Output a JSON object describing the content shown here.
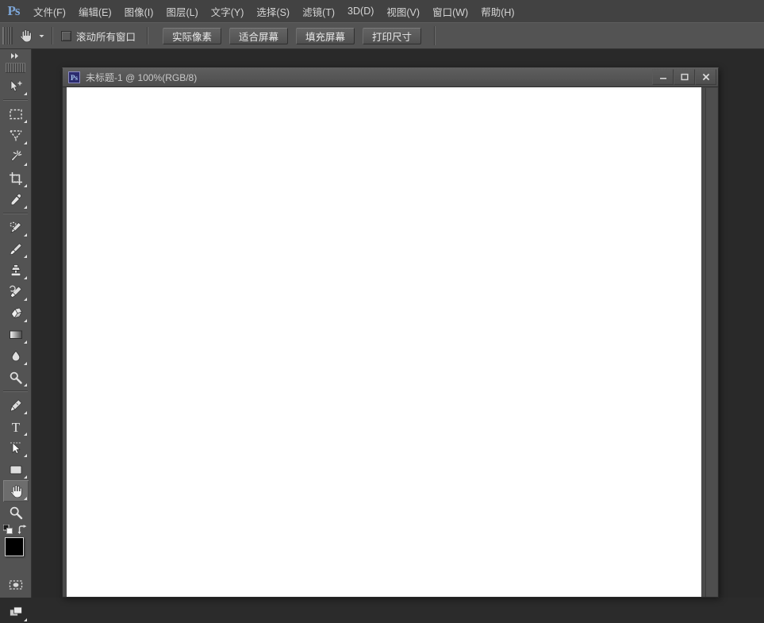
{
  "app": {
    "logo": "Ps",
    "accent_color": "#7da6d8",
    "menubar_bg": "#424242",
    "optionsbar_bg": "#535353",
    "toolbar_bg": "#535353",
    "workspace_bg": "#292929",
    "canvas_bg": "#ffffff"
  },
  "menubar": {
    "items": [
      {
        "label": "文件(F)",
        "name": "menu-file"
      },
      {
        "label": "编辑(E)",
        "name": "menu-edit"
      },
      {
        "label": "图像(I)",
        "name": "menu-image"
      },
      {
        "label": "图层(L)",
        "name": "menu-layer"
      },
      {
        "label": "文字(Y)",
        "name": "menu-type"
      },
      {
        "label": "选择(S)",
        "name": "menu-select"
      },
      {
        "label": "滤镜(T)",
        "name": "menu-filter"
      },
      {
        "label": "3D(D)",
        "name": "menu-3d"
      },
      {
        "label": "视图(V)",
        "name": "menu-view"
      },
      {
        "label": "窗口(W)",
        "name": "menu-window"
      },
      {
        "label": "帮助(H)",
        "name": "menu-help"
      }
    ]
  },
  "optionsbar": {
    "active_tool_icon": "hand-icon",
    "preset_caret_icon": "chevron-down-icon",
    "scroll_all_windows": {
      "label": "滚动所有窗口",
      "checked": false
    },
    "buttons": [
      {
        "label": "实际像素",
        "name": "actual-pixels-button"
      },
      {
        "label": "适合屏幕",
        "name": "fit-screen-button"
      },
      {
        "label": "填充屏幕",
        "name": "fill-screen-button"
      },
      {
        "label": "打印尺寸",
        "name": "print-size-button"
      }
    ]
  },
  "toolbar": {
    "expand_icon": "double-chevron-right-icon",
    "active_tool": "hand-tool",
    "tools": [
      {
        "name": "move-tool",
        "icon": "move-icon",
        "has_flyout": true
      },
      {
        "sep": true
      },
      {
        "name": "marquee-tool",
        "icon": "rectangular-marquee-icon",
        "has_flyout": true
      },
      {
        "name": "lasso-tool",
        "icon": "lasso-icon",
        "has_flyout": true
      },
      {
        "name": "quick-selection-tool",
        "icon": "magic-wand-icon",
        "has_flyout": true
      },
      {
        "name": "crop-tool",
        "icon": "crop-icon",
        "has_flyout": true
      },
      {
        "name": "eyedropper-tool",
        "icon": "eyedropper-icon",
        "has_flyout": true
      },
      {
        "sep": true
      },
      {
        "name": "spot-healing-brush-tool",
        "icon": "spot-healing-brush-icon",
        "has_flyout": true
      },
      {
        "name": "brush-tool",
        "icon": "paintbrush-icon",
        "has_flyout": true
      },
      {
        "name": "clone-stamp-tool",
        "icon": "clone-stamp-icon",
        "has_flyout": true
      },
      {
        "name": "history-brush-tool",
        "icon": "history-brush-icon",
        "has_flyout": true
      },
      {
        "name": "eraser-tool",
        "icon": "eraser-icon",
        "has_flyout": true
      },
      {
        "name": "gradient-tool",
        "icon": "gradient-icon",
        "has_flyout": true
      },
      {
        "name": "blur-tool",
        "icon": "blur-drop-icon",
        "has_flyout": true
      },
      {
        "name": "dodge-tool",
        "icon": "dodge-icon",
        "has_flyout": true
      },
      {
        "sep": true
      },
      {
        "name": "pen-tool",
        "icon": "pen-icon",
        "has_flyout": true
      },
      {
        "name": "type-tool",
        "icon": "text-t-icon",
        "has_flyout": true
      },
      {
        "name": "path-selection-tool",
        "icon": "path-arrow-icon",
        "has_flyout": true
      },
      {
        "name": "rectangle-tool",
        "icon": "rectangle-shape-icon",
        "has_flyout": true
      },
      {
        "name": "hand-tool",
        "icon": "hand-icon",
        "has_flyout": true,
        "active": true
      },
      {
        "name": "zoom-tool",
        "icon": "magnifier-icon",
        "has_flyout": false
      }
    ],
    "color_swatches": {
      "foreground": "#000000",
      "background": "#ffffff",
      "default_icon": "default-colors-icon",
      "swap_icon": "swap-colors-icon"
    },
    "quick_mask": {
      "name": "quick-mask-button",
      "icon": "quick-mask-icon"
    },
    "screen_mode": {
      "name": "screen-mode-button",
      "icon": "screen-mode-icon"
    }
  },
  "document": {
    "title": "未标题-1 @ 100%(RGB/8)",
    "icon": "Ps",
    "zoom": "100%",
    "color_mode": "RGB/8",
    "window_buttons": [
      {
        "name": "minimize-button",
        "icon": "minimize-icon"
      },
      {
        "name": "maximize-button",
        "icon": "maximize-icon"
      },
      {
        "name": "close-button",
        "icon": "close-icon"
      }
    ]
  }
}
